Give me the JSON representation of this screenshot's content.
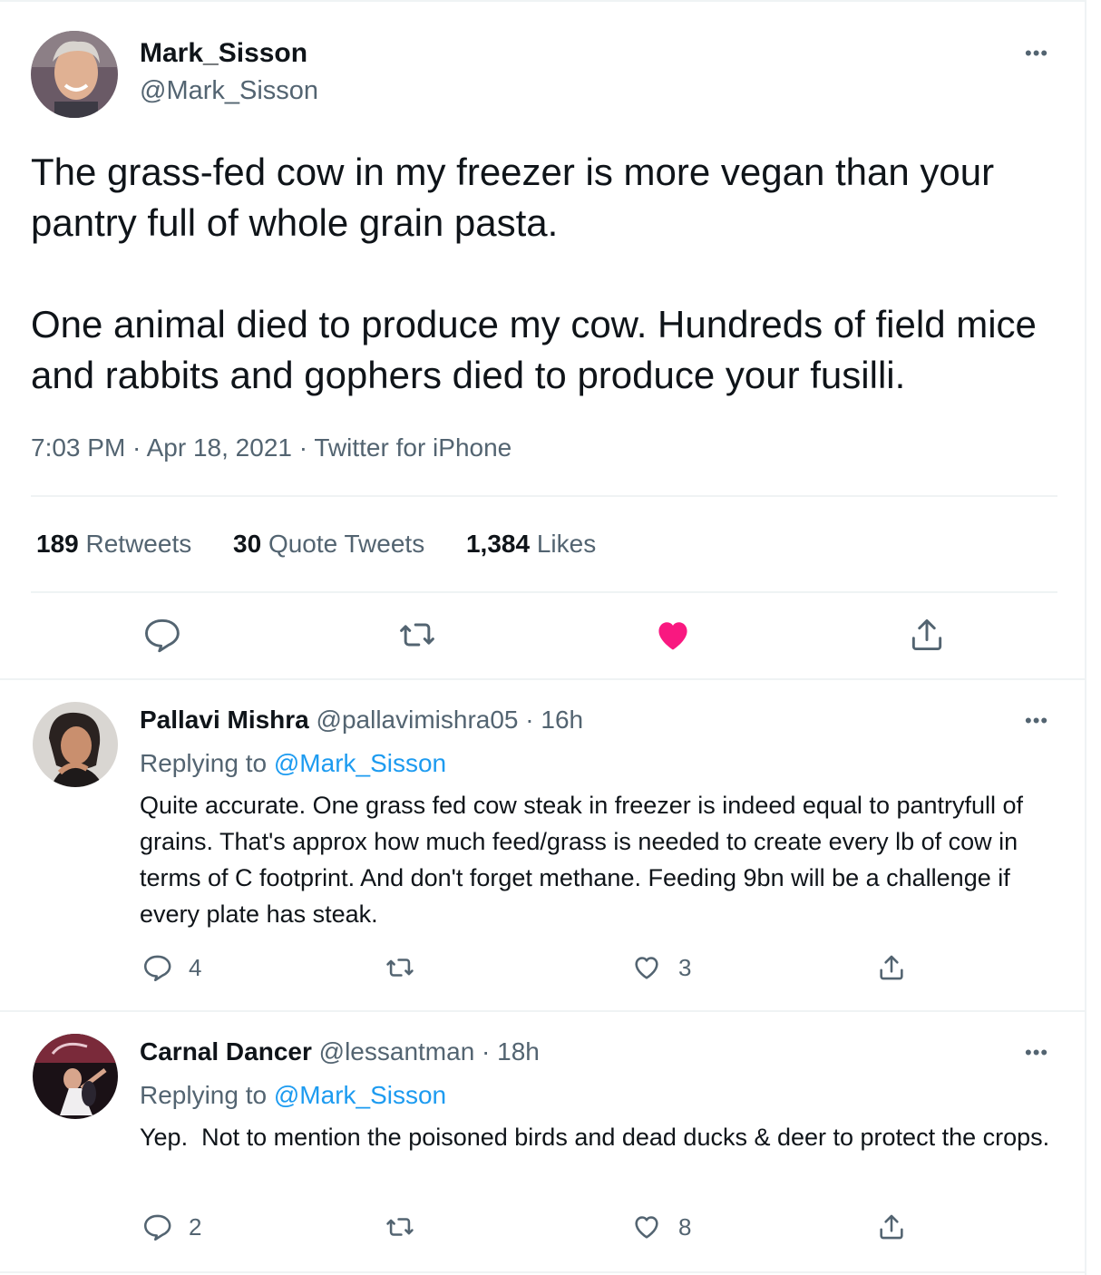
{
  "tweet": {
    "author_name": "Mark_Sisson",
    "author_handle": "@Mark_Sisson",
    "text": "The grass-fed cow in my freezer is more vegan than your pantry full of whole grain pasta.\n\nOne animal died to produce my cow. Hundreds of field mice and rabbits and gophers died to produce your fusilli.",
    "time": "7:03 PM",
    "date": "Apr 18, 2021",
    "source": "Twitter for iPhone",
    "separator": " · ",
    "stats": {
      "retweets_count": "189",
      "retweets_label": "Retweets",
      "quotes_count": "30",
      "quotes_label": "Quote Tweets",
      "likes_count": "1,384",
      "likes_label": "Likes"
    },
    "liked": true
  },
  "replies": [
    {
      "name": "Pallavi Mishra",
      "handle": "@pallavimishra05",
      "time": "16h",
      "replying_label": "Replying to",
      "replying_to": "@Mark_Sisson",
      "text": "Quite accurate. One grass fed cow steak in freezer is indeed equal to pantryfull of grains. That's approx how much feed/grass is needed to create every lb of cow in terms of C footprint. And don't forget methane. Feeding 9bn will be a challenge if every plate has steak.",
      "reply_count": "4",
      "retweet_count": "",
      "like_count": "3"
    },
    {
      "name": "Carnal Dancer",
      "handle": "@lessantman",
      "time": "18h",
      "replying_label": "Replying to",
      "replying_to": "@Mark_Sisson",
      "text": "Yep.  Not to mention the poisoned birds and dead ducks & deer to protect the crops.",
      "reply_count": "2",
      "retweet_count": "",
      "like_count": "8"
    }
  ],
  "more_label": "•••",
  "colors": {
    "text_primary": "#0f1419",
    "text_secondary": "#536471",
    "link": "#1d9bf0",
    "like": "#f91880",
    "divider": "#eff3f4"
  },
  "icons": {
    "reply": "reply-icon",
    "retweet": "retweet-icon",
    "like": "heart-icon",
    "share": "share-icon",
    "more": "more-icon"
  }
}
